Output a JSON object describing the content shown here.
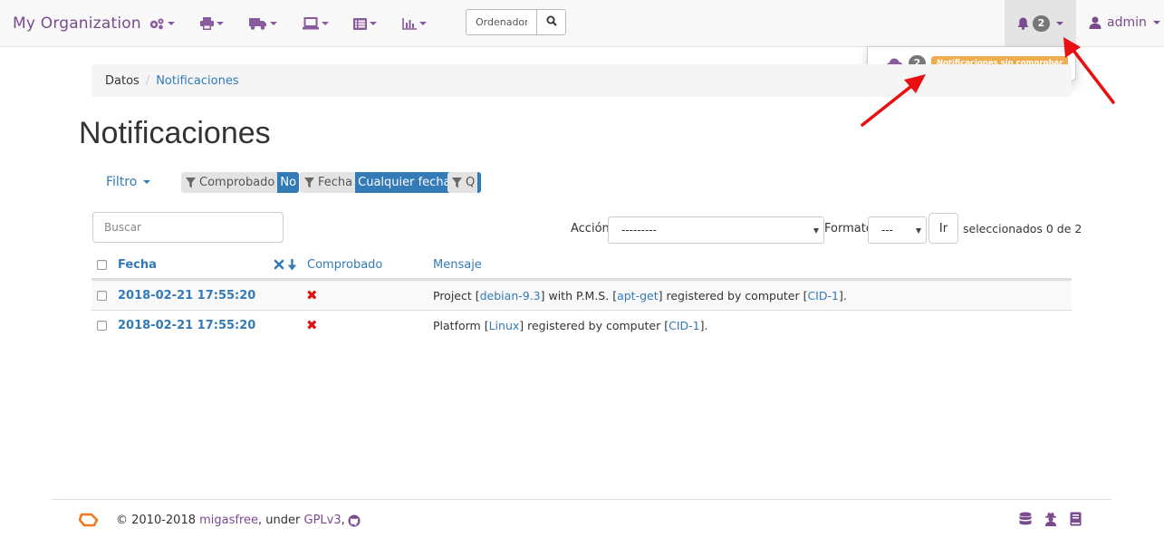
{
  "navbar": {
    "brand": "My Organization",
    "search_placeholder": "Ordenador",
    "notification_count": "2",
    "user": "admin",
    "menu_icons": [
      "gears-icon",
      "printer-icon",
      "truck-icon",
      "laptop-icon",
      "list-icon",
      "chart-icon"
    ]
  },
  "dropdown": {
    "count": "2",
    "label": "Notificaciones sin comprobar"
  },
  "breadcrumb": {
    "root": "Datos",
    "current": "Notificaciones"
  },
  "page": {
    "title": "Notificaciones"
  },
  "filters": {
    "menu_label": "Filtro",
    "chips": [
      {
        "key": "Comprobado",
        "value": "No"
      },
      {
        "key": "Fecha",
        "value": "Cualquier fecha"
      },
      {
        "key": "Q",
        "value": ""
      }
    ]
  },
  "controls": {
    "search_placeholder": "Buscar",
    "action_label": "Acción:",
    "action_value": "---------",
    "format_label": "Formato",
    "format_value": "---",
    "go_label": "Ir",
    "selected_text": "seleccionados 0 de 2"
  },
  "table": {
    "headers": {
      "date": "Fecha",
      "checked": "Comprobado",
      "message": "Mensaje"
    },
    "rows": [
      {
        "date": "2018-02-21 17:55:20",
        "checked": "✖",
        "msg_parts": [
          "Project [",
          "debian-9.3",
          "] with P.M.S. [",
          "apt-get",
          "] registered by computer [",
          "CID-1",
          "]."
        ]
      },
      {
        "date": "2018-02-21 17:55:20",
        "checked": "✖",
        "msg_parts": [
          "Platform [",
          "Linux",
          "] registered by computer [",
          "CID-1",
          "]."
        ]
      }
    ]
  },
  "footer": {
    "copyright": "© 2010-2018 ",
    "project": "migasfree",
    "under": ", under ",
    "license": "GPLv3",
    "comma": ","
  },
  "colors": {
    "brand": "#7a4a8e",
    "link": "#337ab7",
    "warning": "#f0ad4e",
    "danger": "#e01010",
    "annotation_arrow": "#e81010"
  }
}
